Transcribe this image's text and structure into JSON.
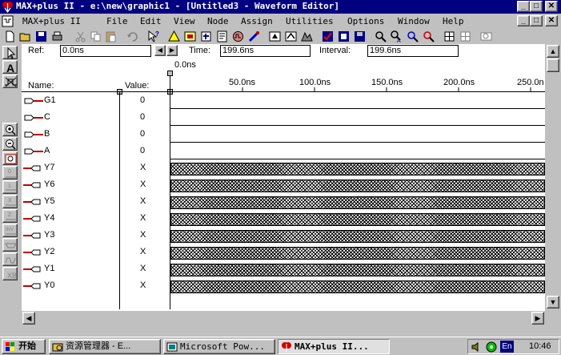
{
  "window": {
    "title": "MAX+plus II - e:\\new\\graphic1 - [Untitled3 - Waveform Editor]",
    "min_glyph": "_",
    "max_glyph": "□",
    "close_glyph": "✕"
  },
  "menus": [
    "MAX+plus II",
    "File",
    "Edit",
    "View",
    "Node",
    "Assign",
    "Utilities",
    "Options",
    "Window",
    "Help"
  ],
  "header": {
    "ref_label": "Ref:",
    "ref_value": "0.0ns",
    "time_label": "Time:",
    "time_value": "199.6ns",
    "interval_label": "Interval:",
    "interval_value": "199.6ns",
    "cursor_time": "0.0ns",
    "name_label": "Name:",
    "value_label": "Value:",
    "ticks": [
      "50.0ns",
      "100.0ns",
      "150.0ns",
      "200.0ns",
      "250.0n"
    ]
  },
  "nodes": [
    {
      "name": "G1",
      "value": "0",
      "dir": "input"
    },
    {
      "name": "C",
      "value": "0",
      "dir": "input"
    },
    {
      "name": "B",
      "value": "0",
      "dir": "input"
    },
    {
      "name": "A",
      "value": "0",
      "dir": "input"
    },
    {
      "name": "Y7",
      "value": "X",
      "dir": "output"
    },
    {
      "name": "Y6",
      "value": "X",
      "dir": "output"
    },
    {
      "name": "Y5",
      "value": "X",
      "dir": "output"
    },
    {
      "name": "Y4",
      "value": "X",
      "dir": "output"
    },
    {
      "name": "Y3",
      "value": "X",
      "dir": "output"
    },
    {
      "name": "Y2",
      "value": "X",
      "dir": "output"
    },
    {
      "name": "Y1",
      "value": "X",
      "dir": "output"
    },
    {
      "name": "Y0",
      "value": "X",
      "dir": "output"
    }
  ],
  "taskbar": {
    "start_label": "开始",
    "tasks": [
      "资源管理器 - E...",
      "Microsoft Pow...",
      "MAX+plus II..."
    ],
    "ime_label": "En",
    "clock": "10:46"
  },
  "colors": {
    "titlebar": "#000080",
    "face": "#c0c0c0",
    "node_stub": "#c00000"
  }
}
